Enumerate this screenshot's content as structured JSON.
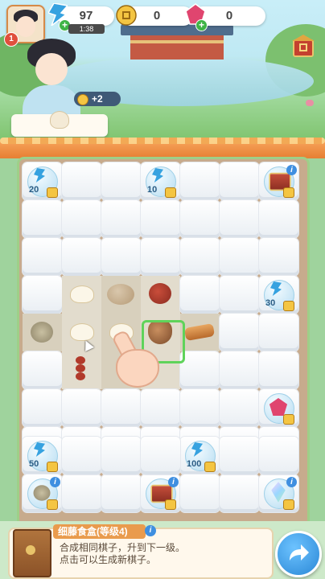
{
  "resources": {
    "energy": "97",
    "energy_timer": "1:38",
    "coins": "0",
    "gems": "0"
  },
  "player": {
    "level": "1"
  },
  "order": {
    "reward": "+2"
  },
  "board_labels": {
    "energy_20": "20",
    "energy_10": "10",
    "energy_30": "30",
    "energy_50": "50",
    "energy_100": "100",
    "info": "i"
  },
  "item_panel": {
    "name": "细藤食盒(等级4)",
    "line1": "合成相同棋子，升到下一级。",
    "line2": "点击可以生成新棋子。",
    "info": "i"
  },
  "colors": {
    "accent_orange": "#e99b4d",
    "energy_blue": "#36a2e0",
    "coin_gold": "#f4c542",
    "gem_pink": "#e0456f",
    "select_green": "#5fd35a"
  }
}
